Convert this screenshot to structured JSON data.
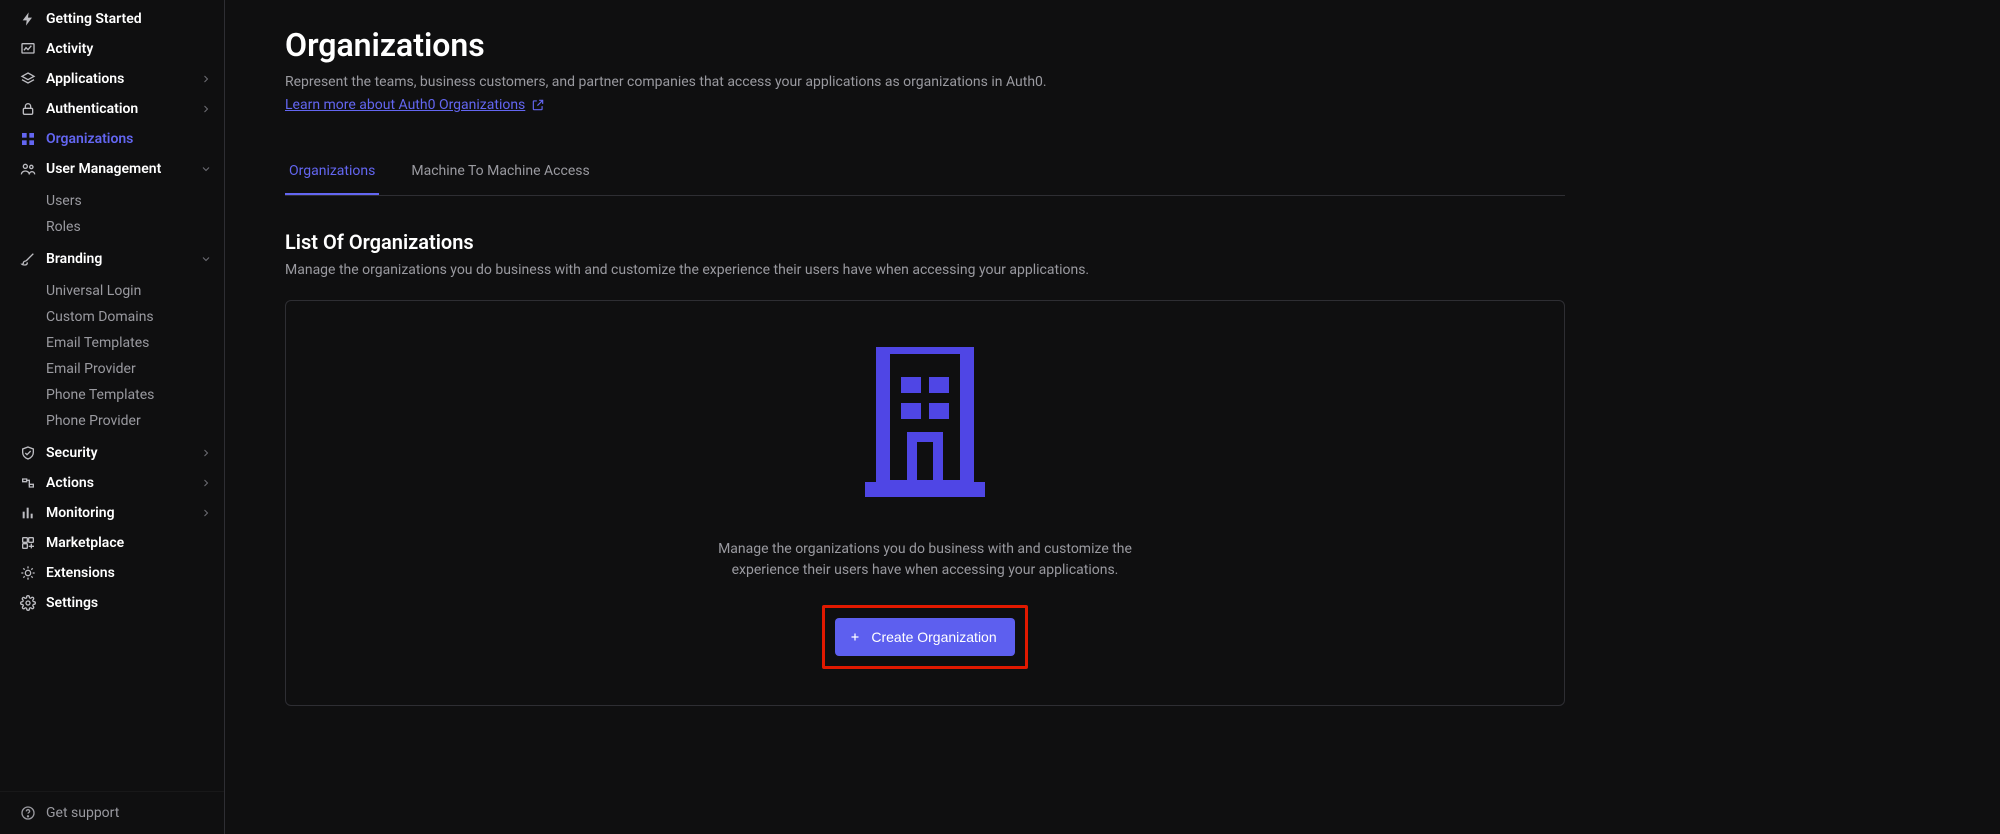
{
  "sidebar": {
    "items": [
      {
        "label": "Getting Started",
        "icon": "bolt-icon",
        "expandable": false,
        "active": false
      },
      {
        "label": "Activity",
        "icon": "chart-line-icon",
        "expandable": false,
        "active": false
      },
      {
        "label": "Applications",
        "icon": "layers-icon",
        "expandable": true,
        "active": false
      },
      {
        "label": "Authentication",
        "icon": "lock-icon",
        "expandable": true,
        "active": false
      },
      {
        "label": "Organizations",
        "icon": "grid-icon",
        "expandable": false,
        "active": true
      },
      {
        "label": "User Management",
        "icon": "users-icon",
        "expandable": true,
        "active": false,
        "expanded": true,
        "children": [
          "Users",
          "Roles"
        ]
      },
      {
        "label": "Branding",
        "icon": "brush-icon",
        "expandable": true,
        "active": false,
        "expanded": true,
        "children": [
          "Universal Login",
          "Custom Domains",
          "Email Templates",
          "Email Provider",
          "Phone Templates",
          "Phone Provider"
        ]
      },
      {
        "label": "Security",
        "icon": "shield-icon",
        "expandable": true,
        "active": false
      },
      {
        "label": "Actions",
        "icon": "flow-icon",
        "expandable": true,
        "active": false
      },
      {
        "label": "Monitoring",
        "icon": "bars-icon",
        "expandable": true,
        "active": false
      },
      {
        "label": "Marketplace",
        "icon": "store-icon",
        "expandable": false,
        "active": false
      },
      {
        "label": "Extensions",
        "icon": "puzzle-icon",
        "expandable": false,
        "active": false
      },
      {
        "label": "Settings",
        "icon": "gear-icon",
        "expandable": false,
        "active": false
      }
    ],
    "footer": {
      "label": "Get support",
      "icon": "help-icon"
    }
  },
  "page": {
    "title": "Organizations",
    "description": "Represent the teams, business customers, and partner companies that access your applications as organizations in Auth0.",
    "learn_link": "Learn more about Auth0 Organizations",
    "tabs": [
      {
        "label": "Organizations",
        "active": true
      },
      {
        "label": "Machine To Machine Access",
        "active": false
      }
    ],
    "section": {
      "title": "List Of Organizations",
      "description": "Manage the organizations you do business with and customize the experience their users have when accessing your applications."
    },
    "empty_state": {
      "description": "Manage the organizations you do business with and customize the experience their users have when accessing your applications.",
      "button_label": "Create Organization"
    }
  },
  "colors": {
    "background": "#0f0f10",
    "accent": "#5d5fef",
    "accent_link": "#6366f1",
    "highlight_box": "#e11900",
    "border": "#2e2e33",
    "text_muted": "#9a9aa0"
  }
}
